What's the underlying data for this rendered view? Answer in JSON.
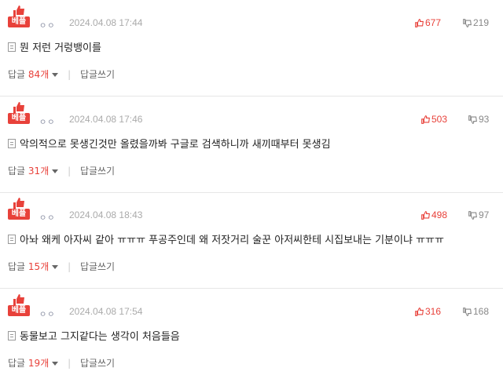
{
  "badge_label": "베플",
  "reply_label": "답글",
  "write_reply_label": "답글쓰기",
  "separator": "|",
  "comments": [
    {
      "author": "ㅇㅇ",
      "date": "2024.04.08 17:44",
      "likes": "677",
      "dislikes": "219",
      "text": "뭔 저런 거렁뱅이를",
      "reply_count": "84개"
    },
    {
      "author": "ㅇㅇ",
      "date": "2024.04.08 17:46",
      "likes": "503",
      "dislikes": "93",
      "text": "악의적으로 못생긴것만 올렸을까봐 구글로 검색하니까 새끼때부터 못생김",
      "reply_count": "31개"
    },
    {
      "author": "ㅇㅇ",
      "date": "2024.04.08 18:43",
      "likes": "498",
      "dislikes": "97",
      "text": "아놔 왜케 아자씨 같아 ㅠㅠㅠ 푸공주인데 왜 저잣거리 술꾼 아저씨한테 시집보내는 기분이냐 ㅠㅠㅠ",
      "reply_count": "15개"
    },
    {
      "author": "ㅇㅇ",
      "date": "2024.04.08 17:54",
      "likes": "316",
      "dislikes": "168",
      "text": "동물보고 그지같다는 생각이 처음들음",
      "reply_count": "19개"
    }
  ]
}
